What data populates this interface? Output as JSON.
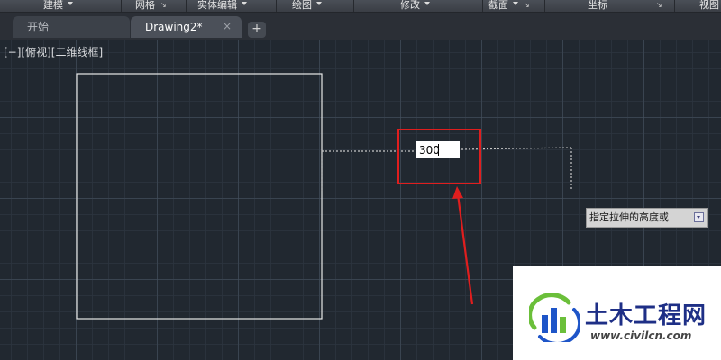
{
  "ribbon": {
    "panels": [
      {
        "label": "建模",
        "has_dropdown": true,
        "has_launcher": false
      },
      {
        "label": "网格",
        "has_dropdown": false,
        "has_launcher": true
      },
      {
        "label": "实体编辑",
        "has_dropdown": true,
        "has_launcher": false
      },
      {
        "label": "绘图",
        "has_dropdown": true,
        "has_launcher": false
      },
      {
        "label": "修改",
        "has_dropdown": true,
        "has_launcher": false
      },
      {
        "label": "截面",
        "has_dropdown": true,
        "has_launcher": true
      },
      {
        "label": "坐标",
        "has_dropdown": false,
        "has_launcher": true
      },
      {
        "label": "视图",
        "has_dropdown": false,
        "has_launcher": false
      }
    ]
  },
  "tabs": [
    {
      "label": "开始",
      "active": false
    },
    {
      "label": "Drawing2*",
      "active": true,
      "close_glyph": "×"
    }
  ],
  "tab_add_glyph": "+",
  "viewport": {
    "view_controls": "[−][俯视][二维线框]",
    "dynamic_input_value": "300",
    "command_prompt": "指定拉伸的高度或",
    "prompt_button_icon": "dropdown-arrow-icon",
    "colors": {
      "background": "#212830",
      "geometry": "#e8e8e8",
      "tracking_line": "#c8c8c8",
      "highlight_box": "#e01e1e",
      "arrow": "#e01e1e"
    }
  },
  "watermark": {
    "title": "土木工程网",
    "url": "www.civilcn.com",
    "colors": {
      "title": "#1e2f86",
      "logo_blue": "#1e55c8",
      "logo_green": "#6bbf3a"
    }
  }
}
